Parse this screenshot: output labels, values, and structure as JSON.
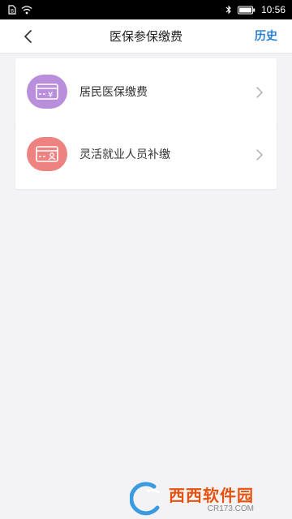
{
  "status_bar": {
    "time": "10:56",
    "icons": [
      "sim-icon",
      "wifi-icon",
      "bluetooth-icon",
      "battery-icon"
    ]
  },
  "nav": {
    "back_icon": "chevron-left-icon",
    "title": "医保参保缴费",
    "history_label": "历史"
  },
  "items": [
    {
      "label": "居民医保缴费",
      "icon": "card-yen-icon",
      "icon_color": "#b98edb"
    },
    {
      "label": "灵活就业人员补缴",
      "icon": "card-person-icon",
      "icon_color": "#ee8280"
    }
  ],
  "colors": {
    "accent": "#2a7fd4",
    "background": "#f3f3f5"
  },
  "watermark": {
    "main": "西西软件园",
    "sub": "CR173.COM"
  }
}
